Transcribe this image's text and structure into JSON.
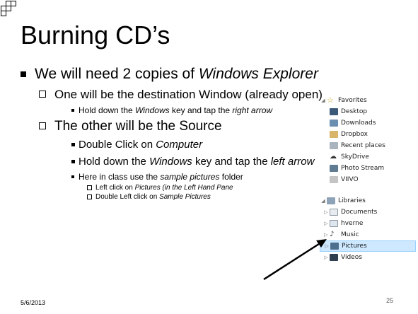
{
  "slide": {
    "title": "Burning CD’s",
    "date": "5/6/2013",
    "page": "25",
    "bullets": {
      "b1_pre": "We will need 2 copies of ",
      "b1_em": "Windows Explorer",
      "b2": "One will be the destination Window (already open)",
      "b3_pre": "Hold down the ",
      "b3_em1": "Windows",
      "b3_mid": " key and tap the ",
      "b3_em2": "right arrow",
      "b4": "The other will be the Source",
      "b5_pre": "Double Click on ",
      "b5_em": "Computer",
      "b6_pre": "Hold down the ",
      "b6_em1": "Windows",
      "b6_mid": " key and tap the ",
      "b6_em2": "left arrow",
      "b7_pre": "Here in class use the ",
      "b7_em": "sample pictures",
      "b7_post": " folder",
      "b8_pre": "Left click on ",
      "b8_em": "Pictures (in the Left Hand Pane",
      "b9_pre": "Double Left click on ",
      "b9_em": "Sample Pictures"
    }
  },
  "explorer": {
    "favorites": {
      "label": "Favorites",
      "items": [
        "Desktop",
        "Downloads",
        "Dropbox",
        "Recent places",
        "SkyDrive",
        "Photo Stream",
        "VIIVO"
      ]
    },
    "libraries": {
      "label": "Libraries",
      "items": [
        "Documents",
        "hverne",
        "Music",
        "Pictures",
        "Videos"
      ],
      "selected": "Pictures"
    }
  }
}
